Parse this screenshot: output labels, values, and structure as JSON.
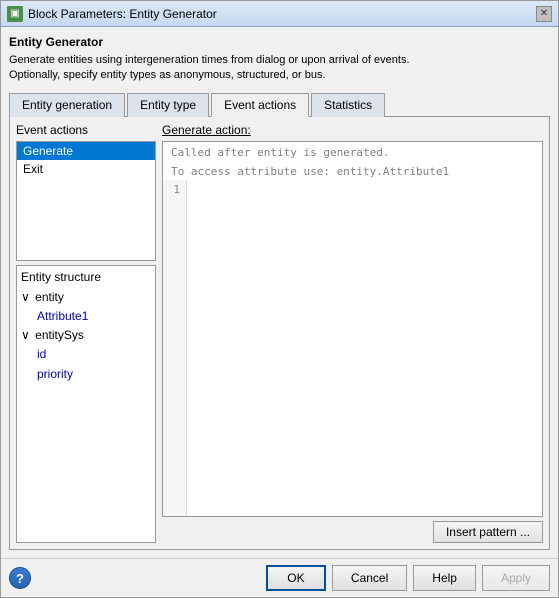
{
  "window": {
    "title": "Block Parameters: Entity Generator",
    "icon_label": "▣",
    "close_label": "✕"
  },
  "body": {
    "section_title": "Entity Generator",
    "description": "Generate entities using intergeneration times from dialog or upon arrival of events.\nOptionally, specify entity types as anonymous, structured, or bus."
  },
  "tabs": [
    {
      "id": "entity-generation",
      "label": "Entity generation",
      "active": false
    },
    {
      "id": "entity-type",
      "label": "Entity type",
      "active": false
    },
    {
      "id": "event-actions",
      "label": "Event actions",
      "active": true
    },
    {
      "id": "statistics",
      "label": "Statistics",
      "active": false
    }
  ],
  "event_actions": {
    "label": "Event actions",
    "items": [
      {
        "id": "generate",
        "label": "Generate",
        "selected": true
      },
      {
        "id": "exit",
        "label": "Exit",
        "selected": false
      }
    ]
  },
  "entity_structure": {
    "title": "Entity structure",
    "nodes": [
      {
        "level": 1,
        "label": "entity",
        "has_toggle": true,
        "toggle": "∨",
        "color": "normal"
      },
      {
        "level": 2,
        "label": "Attribute1",
        "has_toggle": false,
        "color": "blue"
      },
      {
        "level": 1,
        "label": "entitySys",
        "has_toggle": true,
        "toggle": "∨",
        "color": "normal"
      },
      {
        "level": 2,
        "label": "id",
        "has_toggle": false,
        "color": "blue"
      },
      {
        "level": 2,
        "label": "priority",
        "has_toggle": false,
        "color": "blue"
      }
    ]
  },
  "generate_action": {
    "label": "Generate action:",
    "comment_line1": "Called after entity is generated.",
    "comment_line2": "To access attribute use: entity.Attribute1",
    "line_number": "1",
    "code_value": ""
  },
  "insert_pattern_btn": "Insert pattern ...",
  "bottom": {
    "ok_label": "OK",
    "cancel_label": "Cancel",
    "help_label": "Help",
    "apply_label": "Apply",
    "help_icon": "?"
  }
}
